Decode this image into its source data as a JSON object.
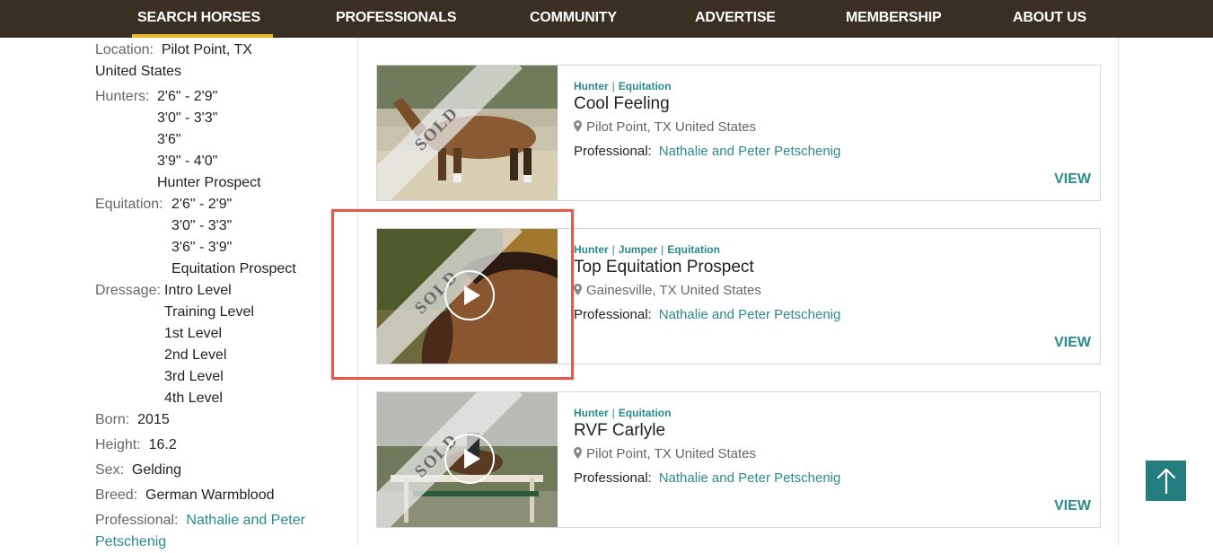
{
  "nav": {
    "items": [
      "SEARCH HORSES",
      "PROFESSIONALS",
      "COMMUNITY",
      "ADVERTISE",
      "MEMBERSHIP",
      "ABOUT US"
    ],
    "active": "SEARCH HORSES"
  },
  "sidebar": {
    "location": {
      "label": "Location:",
      "value1": "Pilot Point, TX",
      "value2": "United States"
    },
    "hunters": {
      "label": "Hunters:",
      "values": [
        "2'6\" - 2'9\"",
        "3'0\" - 3'3\"",
        "3'6\"",
        "3'9\" - 4'0\"",
        "Hunter Prospect"
      ]
    },
    "equitation": {
      "label": "Equitation:",
      "values": [
        "2'6\" - 2'9\"",
        "3'0\" - 3'3\"",
        "3'6\" - 3'9\"",
        "Equitation Prospect"
      ]
    },
    "dressage": {
      "label": "Dressage:",
      "values": [
        "Intro Level",
        "Training Level",
        "1st Level",
        "2nd Level",
        "3rd Level",
        "4th Level"
      ]
    },
    "born": {
      "label": "Born:",
      "value": "2015"
    },
    "height": {
      "label": "Height:",
      "value": "16.2"
    },
    "sex": {
      "label": "Sex:",
      "value": "Gelding"
    },
    "breed": {
      "label": "Breed:",
      "value": "German Warmblood"
    },
    "professional": {
      "label": "Professional:",
      "value1": "Nathalie and Peter",
      "value2": "Petschenig"
    }
  },
  "listings": [
    {
      "categories": [
        "Hunter",
        "Equitation"
      ],
      "title": "Cool Feeling",
      "location": "Pilot Point, TX United States",
      "professional_label": "Professional:",
      "professional": "Nathalie and Peter Petschenig",
      "view": "VIEW",
      "badge": "SOLD",
      "has_video": false
    },
    {
      "categories": [
        "Hunter",
        "Jumper",
        "Equitation"
      ],
      "title": "Top Equitation Prospect",
      "location": "Gainesville, TX United States",
      "professional_label": "Professional:",
      "professional": "Nathalie and Peter Petschenig",
      "view": "VIEW",
      "badge": "SOLD",
      "has_video": true
    },
    {
      "categories": [
        "Hunter",
        "Equitation"
      ],
      "title": "RVF Carlyle",
      "location": "Pilot Point, TX United States",
      "professional_label": "Professional:",
      "professional": "Nathalie and Peter Petschenig",
      "view": "VIEW",
      "badge": "SOLD",
      "has_video": true
    }
  ],
  "colors": {
    "nav_bg": "#3a2f23",
    "nav_active": "#e8b92b",
    "accent": "#2b8a8c",
    "highlight": "#e8584a",
    "scroll_top_bg": "#267d80"
  },
  "icons": {
    "location": "map-pin-icon",
    "play": "play-icon",
    "scroll_top": "arrow-up-icon"
  }
}
